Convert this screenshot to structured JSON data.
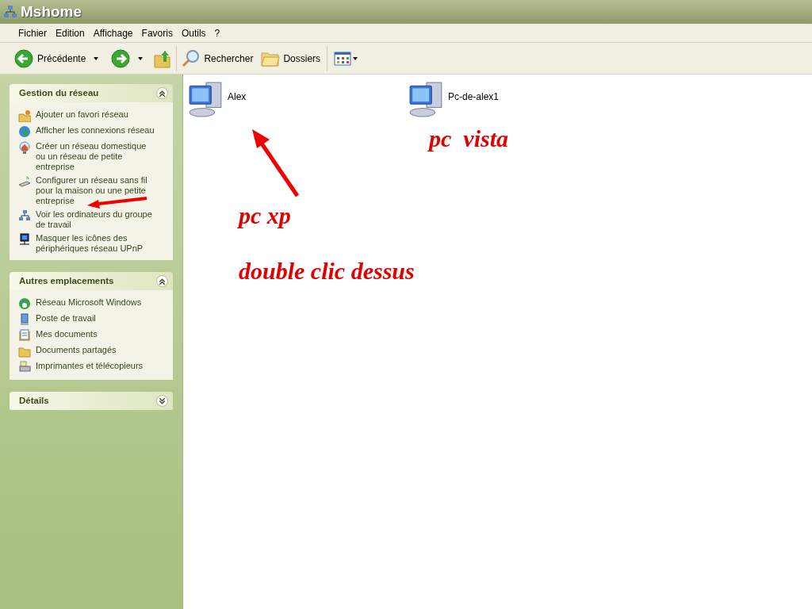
{
  "window": {
    "title": "Mshome"
  },
  "menu": [
    "Fichier",
    "Edition",
    "Affichage",
    "Favoris",
    "Outils",
    "?"
  ],
  "toolbar": {
    "back": "Précédente",
    "search": "Rechercher",
    "folders": "Dossiers"
  },
  "sidebar": [
    {
      "title": "Gestion du réseau",
      "expanded": true,
      "items": [
        "Ajouter un favori réseau",
        "Afficher les connexions réseau",
        "Créer un réseau domestique ou un réseau de petite entreprise",
        "Configurer un réseau sans fil pour la maison ou une petite entreprise",
        "Voir les ordinateurs du groupe de travail",
        "Masquer les icônes des périphériques réseau UPnP"
      ]
    },
    {
      "title": "Autres emplacements",
      "expanded": true,
      "items": [
        "Réseau Microsoft Windows",
        "Poste de travail",
        "Mes documents",
        "Documents partagés",
        "Imprimantes et télécopieurs"
      ]
    },
    {
      "title": "Détails",
      "expanded": false
    }
  ],
  "computers": [
    "Alex",
    "Pc-de-alex1"
  ],
  "annotations": [
    "pc  vista",
    "pc xp",
    "double clic dessus"
  ]
}
